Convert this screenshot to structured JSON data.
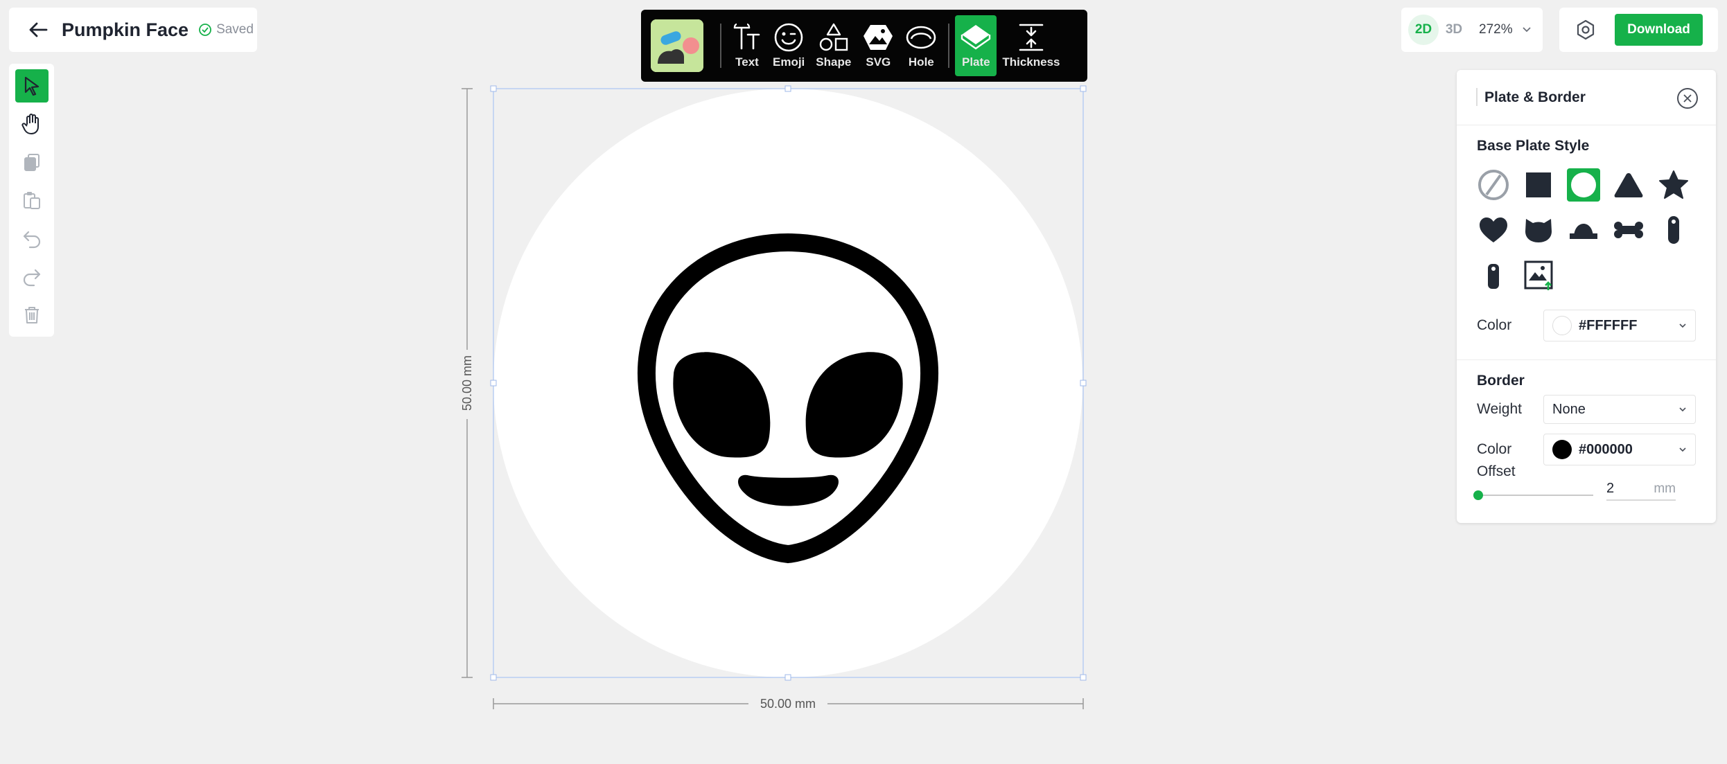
{
  "title_card": {
    "title": "Pumpkin Face",
    "saved_label": "Saved"
  },
  "left_tools": [
    {
      "name": "select-tool",
      "icon": "cursor-arrow-icon",
      "active": true
    },
    {
      "name": "pan-tool",
      "icon": "hand-icon"
    },
    {
      "name": "copy-tool",
      "icon": "copy-icon"
    },
    {
      "name": "paste-tool",
      "icon": "paste-icon"
    },
    {
      "name": "undo-tool",
      "icon": "undo-icon"
    },
    {
      "name": "redo-tool",
      "icon": "redo-icon"
    },
    {
      "name": "delete-tool",
      "icon": "trash-icon"
    }
  ],
  "toolbar": {
    "text_label": "Text",
    "emoji_label": "Emoji",
    "shape_label": "Shape",
    "svg_label": "SVG",
    "hole_label": "Hole",
    "plate_label": "Plate",
    "thickness_label": "Thickness",
    "active": "Plate"
  },
  "view": {
    "mode_2d": "2D",
    "mode_3d": "3D",
    "active_mode": "2D",
    "zoom": "272%"
  },
  "actions": {
    "download_label": "Download"
  },
  "canvas": {
    "height_label": "50.00 mm",
    "width_label": "50.00 mm",
    "plate_color": "#FFFFFF"
  },
  "panel": {
    "title": "Plate & Border",
    "base_plate_style_title": "Base Plate Style",
    "shapes": [
      "none-icon",
      "square-icon",
      "circle-icon",
      "triangle-icon",
      "star-icon",
      "heart-icon",
      "cat-head-icon",
      "dome-icon",
      "bone-icon",
      "tag-icon",
      "tag-small-icon",
      "image-upload-icon"
    ],
    "selected_shape": "circle-icon",
    "color_label": "Color",
    "color_value": "#FFFFFF",
    "border_title": "Border",
    "weight_label": "Weight",
    "weight_value": "None",
    "border_color_label": "Color",
    "border_color_value": "#000000",
    "offset_label": "Offset",
    "offset_value": "2",
    "offset_unit": "mm"
  },
  "colors": {
    "accent": "#16b14a",
    "toolbar_bg": "#050505",
    "canvas_bg": "#f0f0f0"
  }
}
